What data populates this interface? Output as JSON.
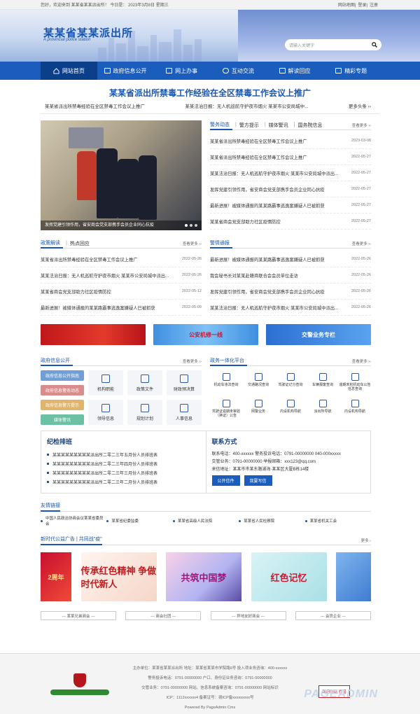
{
  "topbar": {
    "greeting": "您好，欢迎来到 某某省某某派出所！ 今日是：  2023年3月8日 星期三",
    "links": [
      "网站地图",
      "登录",
      "注册"
    ]
  },
  "header": {
    "title": "某某省某某派出所",
    "subtitle": "A provincial police station",
    "search_placeholder": "请输入关键字"
  },
  "nav": [
    {
      "label": "网站首页",
      "icon": "home-icon"
    },
    {
      "label": "政府信息公开",
      "icon": "doc-icon"
    },
    {
      "label": "网上办事",
      "icon": "monitor-icon"
    },
    {
      "label": "互动交流",
      "icon": "chat-icon"
    },
    {
      "label": "解读回应",
      "icon": "mail-icon"
    },
    {
      "label": "精彩专题",
      "icon": "file-icon"
    }
  ],
  "headline": "某某省派出所禁毒工作经验在全区禁毒工作会议上推广",
  "subline": {
    "left": "某某省派出所禁毒经验在全区禁毒工作会议上推广",
    "mid": "某某法治日报：无人机巡航守护夜市烟火 某某市公安局城中...",
    "more": "更多头条 ››"
  },
  "carousel": {
    "caption": "发挥党建引领作用，省安商会党支部携手会员企业同心抗疫"
  },
  "news_tabs": [
    "警务动态",
    "警方提示",
    "媒体警讯",
    "国务院信息"
  ],
  "news_more": "查看更多 ››",
  "news": [
    {
      "t": "某某省派出所禁毒经验在全区禁毒工作会议上推广",
      "d": "2023-03-08"
    },
    {
      "t": "某某省派出所禁毒经验在全区禁毒工作会议上推广",
      "d": "2022-05-27"
    },
    {
      "t": "某某法治日报：无人机巡航守护夜市烟火 某某市公安局城中派出...",
      "d": "2022-05-27"
    },
    {
      "t": "发挥党建引领作用，省安商会党支部携手会员企业同心抗疫",
      "d": "2022-05-27"
    },
    {
      "t": "最新进展！被媒体通报的某某路霸事逃逸案嫌疑人已被抓获",
      "d": "2022-05-27"
    },
    {
      "t": "某某省商会党支部助力社区疫情防控",
      "d": "2022-05-27"
    }
  ],
  "policy_tabs": [
    "政策解读",
    "热点回应"
  ],
  "policy": [
    {
      "t": "某某省派出所禁毒经验在全区禁毒工作会议上推广",
      "d": "2022-05-26"
    },
    {
      "t": "某某法治日报：无人机巡航守护夜市烟火 某某市公安局城中派出...",
      "d": "2022-05-26"
    },
    {
      "t": "某某省商会党支部助力社区疫情防控",
      "d": "2022-05-12"
    },
    {
      "t": "最新进展！被媒体通报的某某路霸事逃逸案嫌疑人已被抓获",
      "d": "2022-05-09"
    }
  ],
  "alert_tabs": [
    "警情通报"
  ],
  "alerts": [
    {
      "t": "最新进展！被媒体通报的某某路霸事逃逸案嫌疑人已被抓获",
      "d": "2022-05-26"
    },
    {
      "t": "我会秘书长对某某赴赣商联合会会员单位走访",
      "d": "2022-05-26"
    },
    {
      "t": "发挥党建引领作用，省安商会党支部携手会员企业同心抗疫",
      "d": "2022-05-26"
    },
    {
      "t": "某某法治日报：无人机巡航守护夜市烟火 某某市公安局城中派出...",
      "d": "2022-05-26"
    }
  ],
  "banners": [
    "",
    "公安机修一线",
    "交警业务专栏"
  ],
  "gov": {
    "title": "政府信息公开",
    "more": "查看更多 ››",
    "buttons": [
      {
        "label": "政府信息公开指南",
        "color": "#6f9fd6"
      },
      {
        "label": "政府信息警务动态",
        "color": "#d98c8c"
      },
      {
        "label": "政府信息警方提示",
        "color": "#e0b46a"
      },
      {
        "label": "媒体警讯",
        "color": "#6cc1a5"
      }
    ],
    "grid": [
      "机构职能",
      "政策文件",
      "财政预决算",
      "领导信息",
      "规划计划",
      "人事信息"
    ]
  },
  "svc": {
    "title": "政务一体化平台",
    "more": "查看更多 ››",
    "items": [
      "机动车违法查询",
      "交通路况查询",
      "驾驶证记分查询",
      "车辆报废查询",
      "逾期未检机动车公告信息查询",
      "驾驶证逾期未审验（换证）公告",
      "网警业务",
      "内设机构导航",
      "派出所导航",
      "内设机构导航"
    ]
  },
  "discipline": {
    "title": "纪检排班",
    "items": [
      "某某某某某某某某某派出所二零二三年五月份人员排班表",
      "某某某某某某某某某派出所二零二三年四月份人员排班表",
      "某某某某某某某某某派出所二零二三年三月份人员排班表",
      "某某某某某某某某某派出所二零二三年二月份人员排班表"
    ]
  },
  "contact": {
    "title": "联系方式",
    "lines": [
      "联系电话：400-xxxxxx 警务投诉电话：0791-00000000 040-000xxxxx",
      "交管业务：0791-00000000 举报邮箱：xxx123@qq.com",
      "来信地址：某某市市某东路湖海·某某区大厦B栋14楼"
    ],
    "btn1": "公开信件",
    "btn2": "我要写信"
  },
  "friends": {
    "title": "友情链接",
    "items": [
      "中国人民政治协商会议某某省委员会",
      "某某省纪委监委",
      "某某省高级人民法院",
      "某某省人民检察院",
      "某某省机关工会"
    ]
  },
  "ads": {
    "tabs": "新时代公益广告 | 共同战\"疫\"",
    "more": "更多 ›",
    "items": [
      "2周年",
      "传承红色精神 争做时代新人",
      "共筑中国梦",
      "红色记忆",
      ""
    ]
  },
  "selects": [
    "--- 某某兄弟商会 ---",
    "--- 商会社团 ---",
    "--- 异地友好商会 ---",
    "--- 会员企业 ---"
  ],
  "footer": {
    "lines": [
      "主办单位：某某省某某派出所   地址：某某省某某市学院路6号   投入项业务咨询：400-xxxxxx",
      "警务投诉电话：0791-00000000 户口、身份证业务咨询：0791-00000000",
      "交管业务：0791-00000000 网站、信息系统备案咨询：0791-00000000 网站标识",
      "ICP：1112xxxxxx4   备案证号：赣ICP备xxxxxxxxx号",
      "Powered By PageAdmin Cms"
    ],
    "badge": "政府网站 找错",
    "watermark": "PAGEADMIN"
  }
}
